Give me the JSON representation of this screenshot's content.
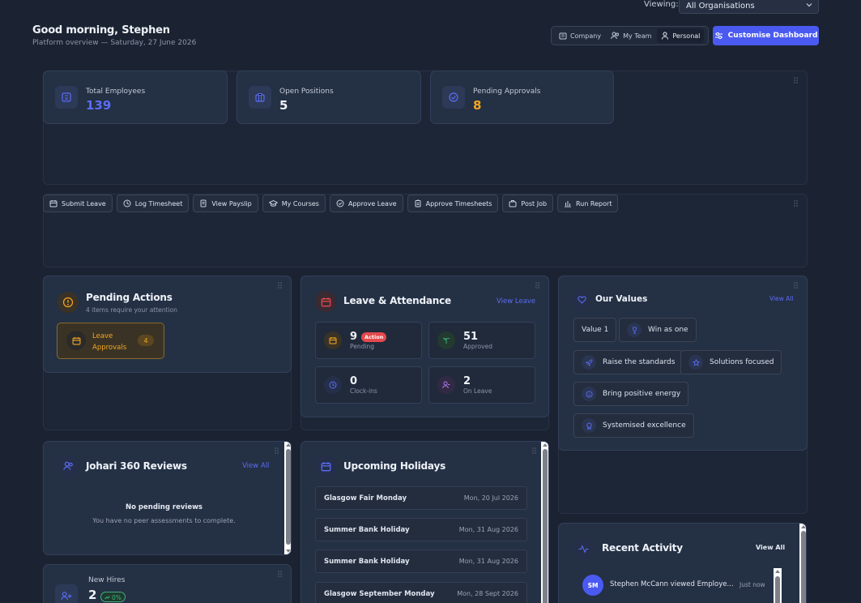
{
  "header": {
    "viewing_label": "Viewing:",
    "org_select_value": "All Organisations",
    "greeting": "Good morning, Stephen",
    "subtitle": "Platform overview — Saturday, 27 June 2026",
    "view_modes": [
      {
        "label": "Company",
        "icon": "building-icon",
        "active": false
      },
      {
        "label": "My Team",
        "icon": "users-icon",
        "active": false
      },
      {
        "label": "Personal",
        "icon": "user-icon",
        "active": true
      }
    ],
    "customise_label": "Customise Dashboard"
  },
  "stats": [
    {
      "label": "Total Employees",
      "value": "139",
      "icon": "building-icon",
      "color": "#5b6cf5"
    },
    {
      "label": "Open Positions",
      "value": "5",
      "icon": "briefcase-icon",
      "color": "#eef2f8"
    },
    {
      "label": "Pending Approvals",
      "value": "8",
      "icon": "check-circle-icon",
      "color": "#f5a623"
    }
  ],
  "quick_actions": [
    {
      "label": "Submit Leave",
      "icon": "calendar-icon"
    },
    {
      "label": "Log Timesheet",
      "icon": "clock-icon"
    },
    {
      "label": "View Payslip",
      "icon": "receipt-icon"
    },
    {
      "label": "My Courses",
      "icon": "graduation-cap-icon"
    },
    {
      "label": "Approve Leave",
      "icon": "check-circle-icon"
    },
    {
      "label": "Approve Timesheets",
      "icon": "clipboard-icon"
    },
    {
      "label": "Post Job",
      "icon": "briefcase-icon"
    },
    {
      "label": "Run Report",
      "icon": "bar-chart-icon"
    }
  ],
  "pending_actions": {
    "title": "Pending Actions",
    "subtitle": "4 items require your attention",
    "item_label": "Leave Approvals",
    "item_count": "4"
  },
  "leave_attendance": {
    "title": "Leave & Attendance",
    "view_link": "View Leave",
    "cards": [
      {
        "value": "9",
        "label": "Pending",
        "badge": "Action",
        "icon": "calendar-icon"
      },
      {
        "value": "51",
        "label": "Approved",
        "icon": "palm-tree-icon"
      },
      {
        "value": "0",
        "label": "Clock-ins",
        "icon": "clock-icon"
      },
      {
        "value": "2",
        "label": "On Leave",
        "icon": "user-minus-icon"
      }
    ]
  },
  "values": {
    "title": "Our Values",
    "view_link": "View All",
    "items": [
      "Value 1",
      "Win as one",
      "Raise the standards",
      "Solutions focused",
      "Bring positive energy",
      "Systemised excellence"
    ]
  },
  "johari": {
    "title": "Johari 360 Reviews",
    "view_link": "View All",
    "empty_title": "No pending reviews",
    "empty_text": "You have no peer assessments to complete."
  },
  "holidays": {
    "title": "Upcoming Holidays",
    "items": [
      {
        "name": "Glasgow Fair Monday",
        "date": "Mon, 20 Jul 2026"
      },
      {
        "name": "Summer Bank Holiday",
        "date": "Mon, 31 Aug 2026"
      },
      {
        "name": "Summer Bank Holiday",
        "date": "Mon, 31 Aug 2026"
      },
      {
        "name": "Glasgow September Monday",
        "date": "Mon, 28 Sept 2026"
      }
    ]
  },
  "new_hires": {
    "label": "New Hires",
    "value": "2",
    "change": "0%"
  },
  "recent_activity": {
    "title": "Recent Activity",
    "view_link": "View All",
    "items": [
      {
        "initials": "SM",
        "text": "Stephen McCann viewed Employe...",
        "time": "Just now"
      }
    ]
  },
  "colors": {
    "accent": "#4a5af0",
    "warning": "#f5a623",
    "danger": "#e5484d",
    "success": "#3fb07a"
  }
}
